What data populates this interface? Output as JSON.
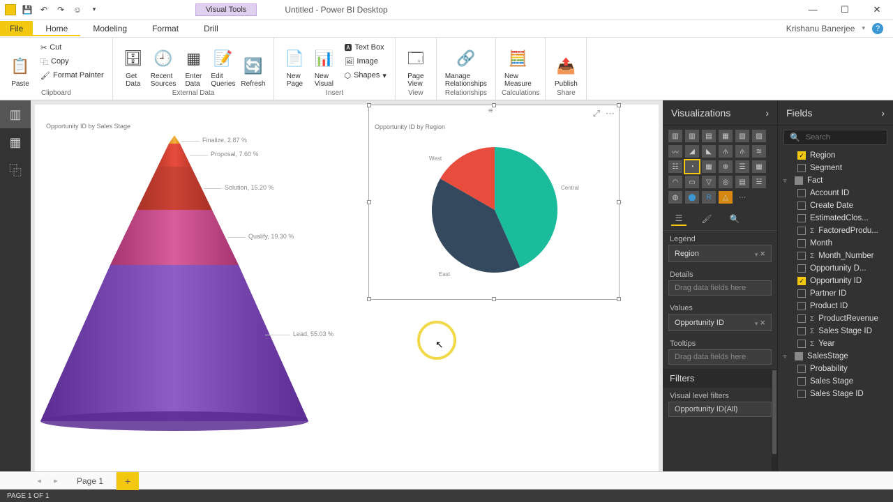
{
  "title": "Untitled - Power BI Desktop",
  "context_tab": "Visual Tools",
  "user": "Krishanu Banerjee",
  "menu_tabs": {
    "file": "File",
    "home": "Home",
    "modeling": "Modeling",
    "format": "Format",
    "drill": "Drill"
  },
  "ribbon": {
    "clipboard": {
      "paste": "Paste",
      "cut": "Cut",
      "copy": "Copy",
      "fmt": "Format Painter",
      "label": "Clipboard"
    },
    "external": {
      "get": "Get\nData",
      "recent": "Recent\nSources",
      "enter": "Enter\nData",
      "edit": "Edit\nQueries",
      "refresh": "Refresh",
      "label": "External Data"
    },
    "insert": {
      "newpage": "New\nPage",
      "newvisual": "New\nVisual",
      "textbox": "Text Box",
      "image": "Image",
      "shapes": "Shapes",
      "label": "Insert"
    },
    "view": {
      "pageview": "Page\nView",
      "label": "View"
    },
    "rel": {
      "manage": "Manage\nRelationships",
      "label": "Relationships"
    },
    "calc": {
      "measure": "New\nMeasure",
      "label": "Calculations"
    },
    "share": {
      "publish": "Publish",
      "label": "Share"
    }
  },
  "pages": {
    "page1": "Page 1"
  },
  "status": "PAGE 1 OF 1",
  "viz_panel": {
    "title": "Visualizations",
    "legend": "Legend",
    "legend_val": "Region",
    "details": "Details",
    "details_ph": "Drag data fields here",
    "values": "Values",
    "values_val": "Opportunity ID",
    "tooltips": "Tooltips",
    "tooltips_ph": "Drag data fields here",
    "filters": "Filters",
    "filters_sub": "Visual level filters",
    "filters_item": "Opportunity ID(All)"
  },
  "fields_panel": {
    "title": "Fields",
    "search_ph": "Search",
    "items": [
      {
        "label": "Region",
        "checked": true
      },
      {
        "label": "Segment",
        "checked": false
      }
    ],
    "fact_table": "Fact",
    "fact_items": [
      {
        "label": "Account ID",
        "checked": false
      },
      {
        "label": "Create Date",
        "checked": false
      },
      {
        "label": "EstimatedClos...",
        "checked": false
      },
      {
        "label": "FactoredProdu...",
        "checked": false,
        "sum": true
      },
      {
        "label": "Month",
        "checked": false
      },
      {
        "label": "Month_Number",
        "checked": false,
        "sum": true
      },
      {
        "label": "Opportunity D...",
        "checked": false
      },
      {
        "label": "Opportunity ID",
        "checked": true
      },
      {
        "label": "Partner ID",
        "checked": false
      },
      {
        "label": "Product ID",
        "checked": false
      },
      {
        "label": "ProductRevenue",
        "checked": false,
        "sum": true
      },
      {
        "label": "Sales Stage ID",
        "checked": false,
        "sum": true
      },
      {
        "label": "Year",
        "checked": false,
        "sum": true
      }
    ],
    "sales_table": "SalesStage",
    "sales_items": [
      {
        "label": "Probability",
        "checked": false
      },
      {
        "label": "Sales Stage",
        "checked": false
      },
      {
        "label": "Sales Stage ID",
        "checked": false
      }
    ]
  },
  "chart_data": [
    {
      "type": "funnel",
      "title": "Opportunity ID by Sales Stage",
      "series": [
        {
          "name": "Finalize",
          "value": 2.87
        },
        {
          "name": "Proposal",
          "value": 7.6
        },
        {
          "name": "Solution",
          "value": 15.2
        },
        {
          "name": "Qualify",
          "value": 19.3
        },
        {
          "name": "Lead",
          "value": 55.03
        }
      ],
      "value_suffix": " %"
    },
    {
      "type": "pie",
      "title": "Opportunity ID by Region",
      "series": [
        {
          "name": "Central",
          "value": 43,
          "color": "#1abc9c"
        },
        {
          "name": "East",
          "value": 40,
          "color": "#34495e"
        },
        {
          "name": "West",
          "value": 17,
          "color": "#e74c3c"
        }
      ]
    }
  ],
  "funnel_labels": {
    "l0": "Finalize, 2.87 %",
    "l1": "Proposal, 7.60 %",
    "l2": "Solution, 15.20 %",
    "l3": "Qualify, 19.30 %",
    "l4": "Lead, 55.03 %"
  },
  "pie_labels": {
    "west": "West",
    "central": "Central",
    "east": "East"
  }
}
